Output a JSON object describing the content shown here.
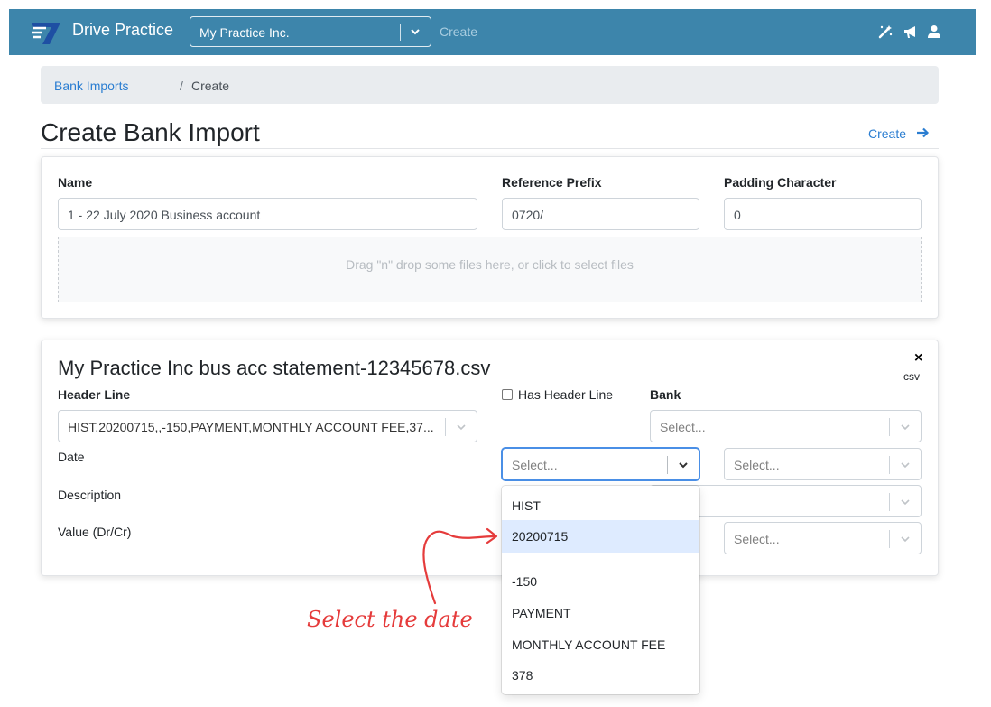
{
  "navbar": {
    "brand": "Drive Practice",
    "company_select": "My Practice Inc.",
    "create_label": "Create",
    "icons": [
      "magic-wand-icon",
      "megaphone-icon",
      "user-icon"
    ]
  },
  "breadcrumb": {
    "link": "Bank Imports",
    "separator": "/",
    "current": "Create"
  },
  "page": {
    "title": "Create Bank Import",
    "create_link": "Create"
  },
  "import_form": {
    "name_label": "Name",
    "name_value": "1 - 22 July 2020 Business account",
    "reference_prefix_label": "Reference Prefix",
    "reference_prefix_value": "0720/",
    "padding_label": "Padding Character",
    "padding_value": "0",
    "dropzone_text": "Drag \"n\" drop some files here, or click to select files"
  },
  "file_card": {
    "file_name": "My Practice Inc bus acc statement-12345678.csv",
    "close": "×",
    "file_type": "csv",
    "header_line_label": "Header Line",
    "header_line_value": "HIST,20200715,,-150,PAYMENT,MONTHLY ACCOUNT FEE,37...",
    "has_header_label": "Has Header Line",
    "bank_label": "Bank",
    "bank_placeholder": "Select...",
    "date_label": "Date",
    "date_placeholder": "Select...",
    "date_format_placeholder": "Select...",
    "description_label": "Description",
    "value_label": "Value (Dr/Cr)",
    "value_format_placeholder": "Select..."
  },
  "dropdown_options": [
    "HIST",
    "20200715",
    "",
    "-150",
    "PAYMENT",
    "MONTHLY ACCOUNT FEE",
    "378"
  ],
  "highlighted_option": "20200715",
  "annotation": {
    "text": "Select the date",
    "color": "#e53b3b"
  },
  "colors": {
    "navbar": "#3d85ab",
    "link": "#2a7dd1",
    "focus": "#4a8fe6",
    "option_highlight": "#deebff"
  }
}
